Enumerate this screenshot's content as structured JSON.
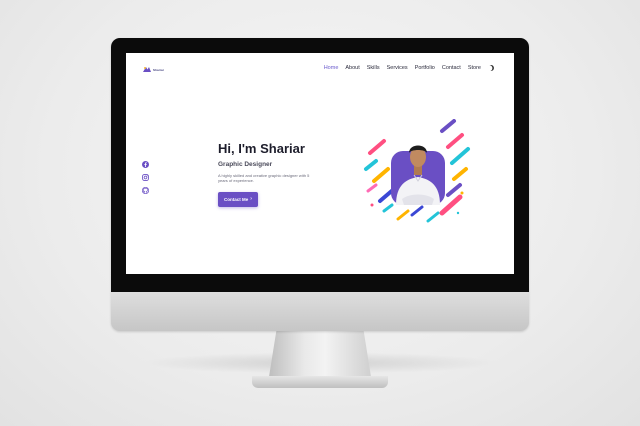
{
  "page": {
    "logo_text": "Shariar"
  },
  "nav": {
    "items": [
      {
        "label": "Home",
        "active": true
      },
      {
        "label": "About",
        "active": false
      },
      {
        "label": "Skills",
        "active": false
      },
      {
        "label": "Services",
        "active": false
      },
      {
        "label": "Portfolio",
        "active": false
      },
      {
        "label": "Contact",
        "active": false
      },
      {
        "label": "Store",
        "active": false
      }
    ],
    "theme_toggle_icon": "moon-icon"
  },
  "socials": [
    {
      "icon": "facebook-icon"
    },
    {
      "icon": "instagram-icon"
    },
    {
      "icon": "github-icon"
    }
  ],
  "hero": {
    "title": "Hi, I'm Shariar",
    "subtitle": "Graphic Designer",
    "description": "A highly skilled and creative graphic designer with 5 years of experience.",
    "cta_label": "Contact Me",
    "cta_icon": "send-icon"
  },
  "colors": {
    "accent": "#6a4fc4",
    "nav_active": "#6a5acd",
    "text_dark": "#1d1d2b",
    "monitor_bezel": "#0b0b0b"
  }
}
